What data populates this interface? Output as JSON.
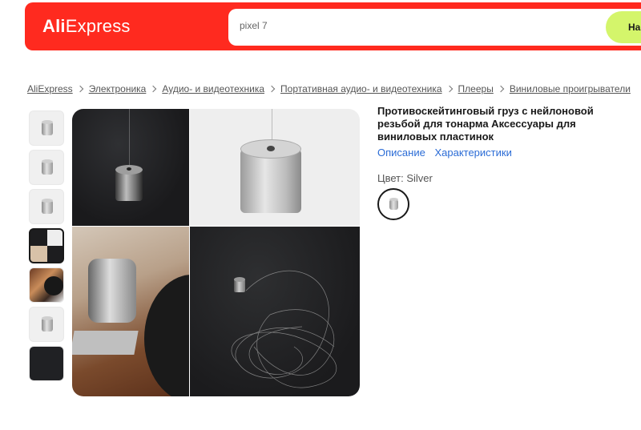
{
  "header": {
    "logo_main": "Ali",
    "logo_sub": "Express",
    "search_value": "pixel 7",
    "search_button": "На"
  },
  "breadcrumb": [
    "AliExpress",
    "Электроника",
    "Аудио- и видеотехника",
    "Портативная аудио- и видеотехника",
    "Плееры",
    "Виниловые проигрыватели"
  ],
  "product": {
    "title": "Противоскейтинговый груз с нейлоновой резьбой для тонарма Аксессуары для виниловых пластинок",
    "links": [
      "Описание",
      "Характеристики"
    ],
    "color_label": "Цвет: Silver",
    "selected_color": "Silver"
  },
  "thumbnails": [
    "weight-closeup-1",
    "weight-closeup-2",
    "weight-closeup-3",
    "collage",
    "turntable-photo",
    "weight-dimension",
    "dark-background"
  ],
  "colors": {
    "brand_red": "#ff2a1f",
    "search_button": "#d4f56b",
    "link": "#2b6cd6"
  }
}
